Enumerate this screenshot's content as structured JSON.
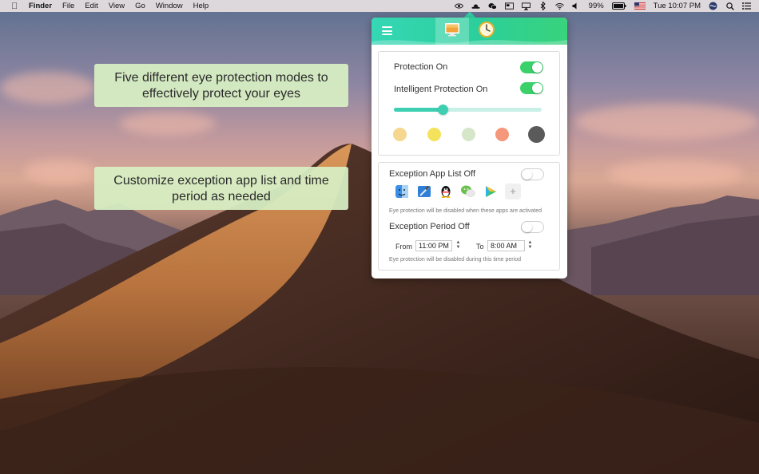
{
  "menubar": {
    "apple_icon": "apple-icon",
    "app_name": "Finder",
    "menus": [
      "File",
      "Edit",
      "View",
      "Go",
      "Window",
      "Help"
    ],
    "battery": "99%",
    "clock": "Tue 10:07 PM"
  },
  "callouts": {
    "first": "Five different eye protection modes to effectively protect your eyes",
    "second": "Customize exception app list and time period as needed"
  },
  "panel": {
    "header": {
      "menu_icon": "hamburger-icon",
      "tabs": [
        "display-icon",
        "clock-icon"
      ],
      "active_tab": "display-icon"
    },
    "protection": {
      "protection_label": "Protection On",
      "protection_on": true,
      "intelligent_label": "Intelligent Protection On",
      "intelligent_on": true,
      "intensity": 0.33,
      "modes": [
        "#f6d78f",
        "#f5e25c",
        "#d6e6c8",
        "#f4977a",
        "#5a5a5a"
      ],
      "selected_mode": 4
    },
    "exceptions": {
      "app_list_label": "Exception App List Off",
      "app_list_on": false,
      "apps": [
        "finder-app-icon",
        "xcode-app-icon",
        "qq-app-icon",
        "wechat-app-icon",
        "video-player-app-icon"
      ],
      "add_label": "+",
      "app_hint": "Eye protection will be disabled when these apps are activated",
      "period_label": "Exception Period Off",
      "period_on": false,
      "from_label": "From",
      "from_time": "11:00 PM",
      "to_label": "To",
      "to_time": "8:00 AM",
      "period_hint": "Eye protection will be disabled during this time period"
    }
  },
  "colors": {
    "accent": "#2fd2a7",
    "toggle_on": "#3bd16a",
    "callout_bg": "#d7eec2"
  }
}
